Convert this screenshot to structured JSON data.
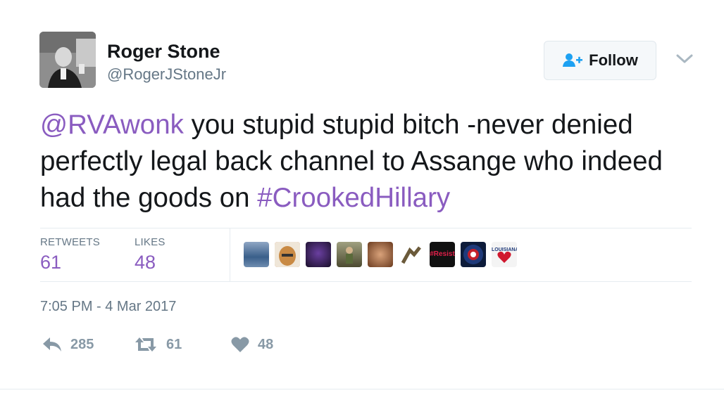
{
  "header": {
    "display_name": "Roger Stone",
    "handle": "@RogerJStoneJr",
    "follow_label": "Follow",
    "icons": [
      "avatar",
      "follow-user-icon",
      "chevron-down-icon"
    ]
  },
  "tweet": {
    "mention": "@RVAwonk",
    "text_part1": " you stupid stupid bitch -never denied perfectly legal back channel to Assange who indeed had the goods on ",
    "hashtag": "#CrookedHillary"
  },
  "stats": {
    "retweets_label": "RETWEETS",
    "retweets_value": "61",
    "likes_label": "LIKES",
    "likes_value": "48"
  },
  "likers": {
    "resist_label": "#Resist",
    "louisiana_label": "LOUISIANA"
  },
  "timestamp": "7:05 PM - 4 Mar 2017",
  "actions": {
    "reply_count": "285",
    "retweet_count": "61",
    "like_count": "48",
    "icons": [
      "reply-icon",
      "retweet-icon",
      "heart-icon"
    ]
  },
  "colors": {
    "link": "#8a5cc0",
    "muted": "#657786",
    "action_gray": "#8899a6"
  }
}
